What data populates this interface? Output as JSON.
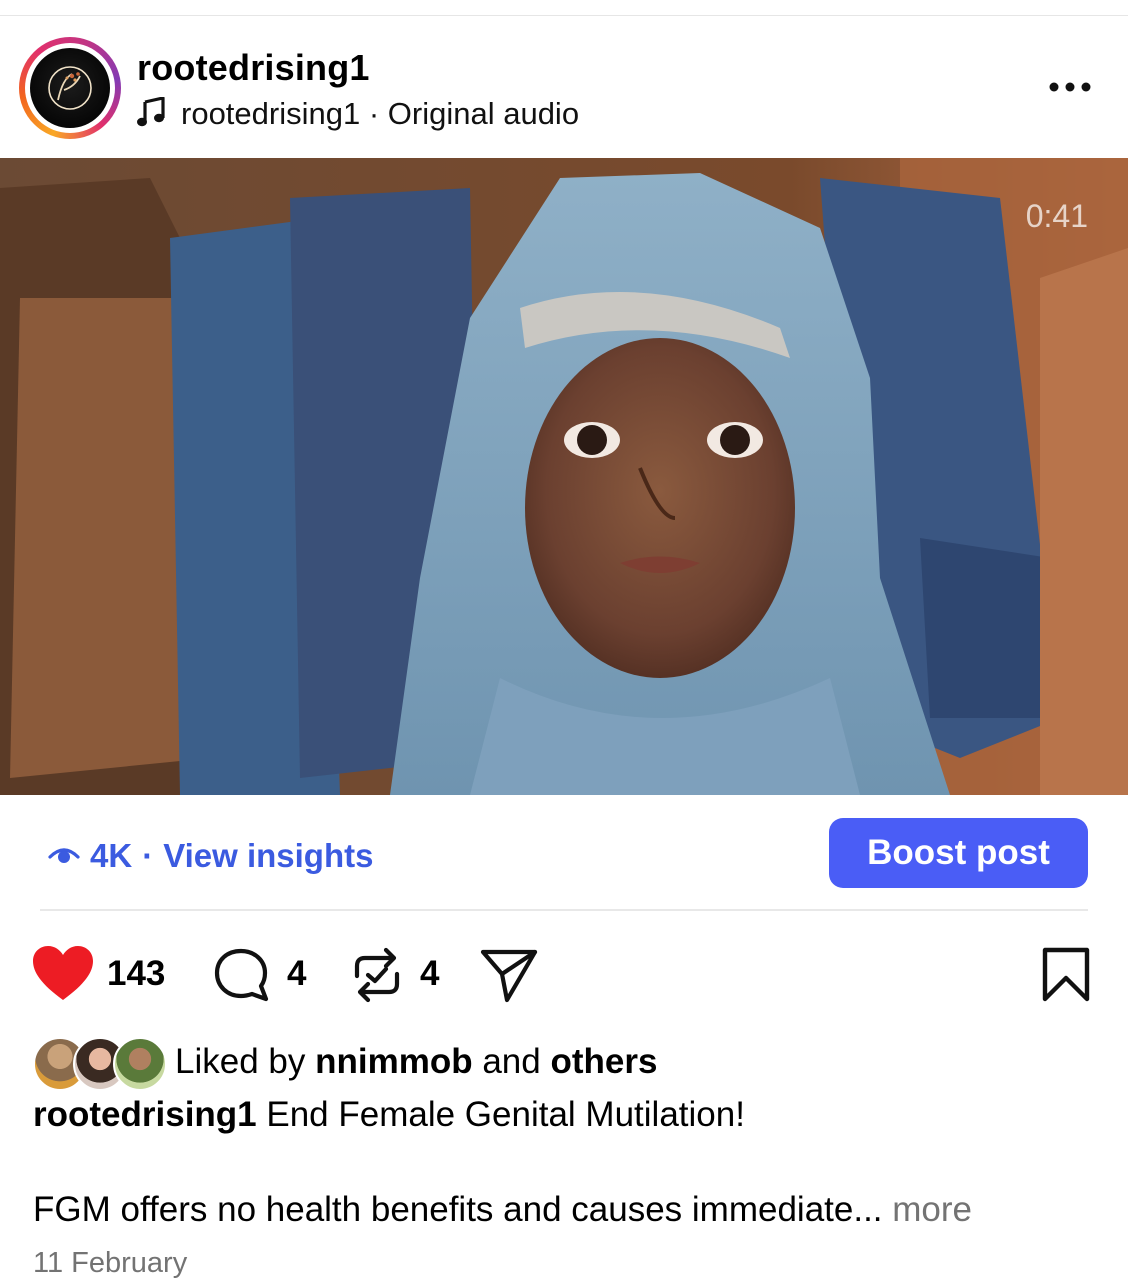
{
  "header": {
    "username": "rootedrising1",
    "audio_owner": "rootedrising1",
    "audio_sep": " · ",
    "audio_label": "Original audio"
  },
  "media": {
    "duration": "0:41"
  },
  "insights": {
    "views": "4K",
    "sep": "·",
    "link_label": "View insights"
  },
  "boost_label": "Boost post",
  "actions": {
    "likes": "143",
    "comments": "4",
    "reposts": "4"
  },
  "liked_by": {
    "prefix": "Liked by",
    "user": "nnimmob",
    "conj": "and",
    "others": "others"
  },
  "caption": {
    "username": "rootedrising1",
    "text": "End Female Genital Mutilation!",
    "body": "FGM offers no health benefits and causes immediate...",
    "more": "more"
  },
  "date": "11 February",
  "colors": {
    "accent": "#4a5df6",
    "link": "#3b5be0",
    "like": "#ed1c24",
    "muted": "#737373"
  }
}
